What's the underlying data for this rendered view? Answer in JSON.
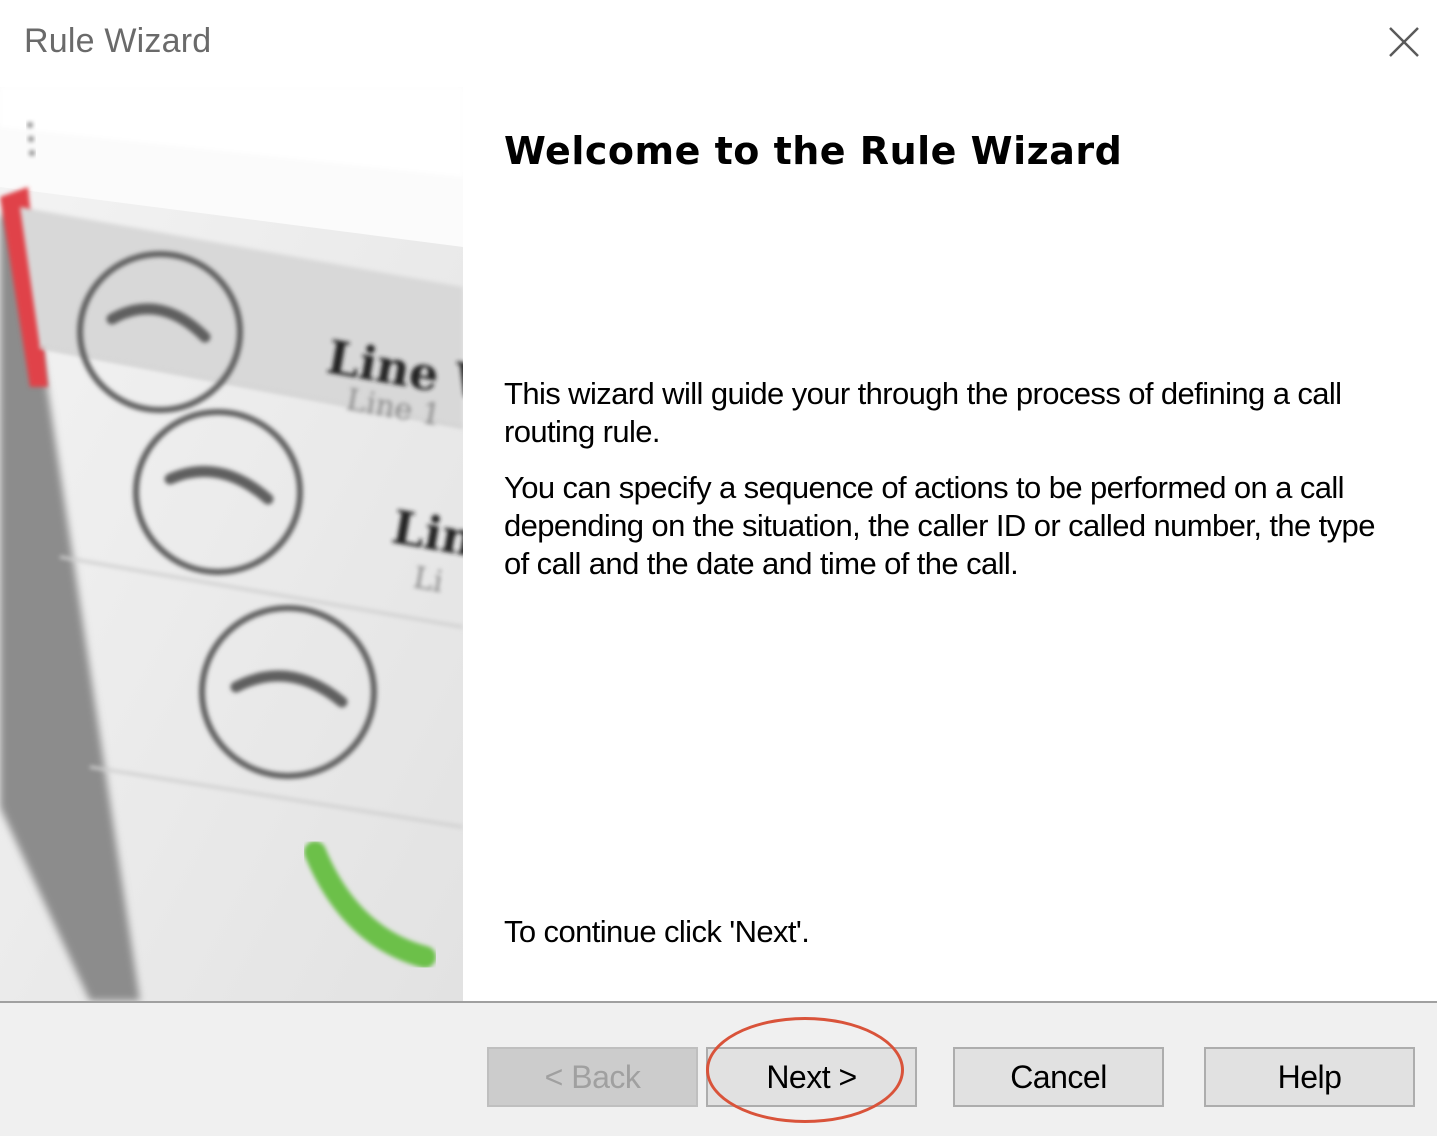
{
  "window": {
    "title": "Rule Wizard",
    "close_icon": "close-icon"
  },
  "side_image": {
    "description_icon": "phone-lines-illustration",
    "line_labels": [
      "Line W",
      "Line 1",
      "Lin",
      "Li"
    ],
    "accent_red": "#e0434a",
    "accent_green": "#6cc04a"
  },
  "content": {
    "heading": "Welcome to the Rule Wizard",
    "paragraph1": "This wizard will guide your through the process of defining a call routing rule.",
    "paragraph2": "You can specify a sequence of actions to be performed on a call depending on the situation, the caller ID or called number, the type of call and the date and time of the call.",
    "paragraph3": "To continue click 'Next'."
  },
  "footer": {
    "back_label": "< Back",
    "back_enabled": false,
    "next_label": "Next >",
    "cancel_label": "Cancel",
    "help_label": "Help"
  },
  "annotation": {
    "color": "#d9533a",
    "target": "next-button"
  }
}
